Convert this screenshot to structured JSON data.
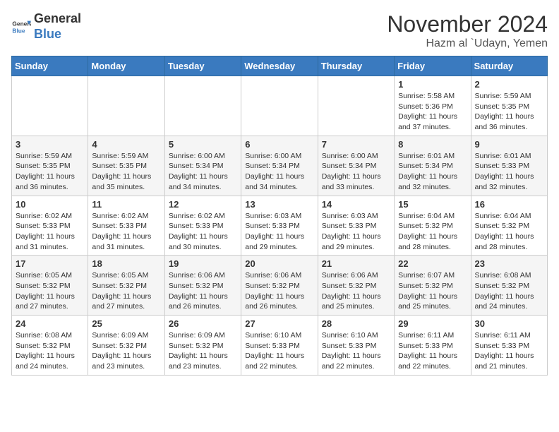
{
  "header": {
    "logo_general": "General",
    "logo_blue": "Blue",
    "month_year": "November 2024",
    "location": "Hazm al `Udayn, Yemen"
  },
  "weekdays": [
    "Sunday",
    "Monday",
    "Tuesday",
    "Wednesday",
    "Thursday",
    "Friday",
    "Saturday"
  ],
  "weeks": [
    [
      {
        "day": "",
        "info": ""
      },
      {
        "day": "",
        "info": ""
      },
      {
        "day": "",
        "info": ""
      },
      {
        "day": "",
        "info": ""
      },
      {
        "day": "",
        "info": ""
      },
      {
        "day": "1",
        "info": "Sunrise: 5:58 AM\nSunset: 5:36 PM\nDaylight: 11 hours and 37 minutes."
      },
      {
        "day": "2",
        "info": "Sunrise: 5:59 AM\nSunset: 5:35 PM\nDaylight: 11 hours and 36 minutes."
      }
    ],
    [
      {
        "day": "3",
        "info": "Sunrise: 5:59 AM\nSunset: 5:35 PM\nDaylight: 11 hours and 36 minutes."
      },
      {
        "day": "4",
        "info": "Sunrise: 5:59 AM\nSunset: 5:35 PM\nDaylight: 11 hours and 35 minutes."
      },
      {
        "day": "5",
        "info": "Sunrise: 6:00 AM\nSunset: 5:34 PM\nDaylight: 11 hours and 34 minutes."
      },
      {
        "day": "6",
        "info": "Sunrise: 6:00 AM\nSunset: 5:34 PM\nDaylight: 11 hours and 34 minutes."
      },
      {
        "day": "7",
        "info": "Sunrise: 6:00 AM\nSunset: 5:34 PM\nDaylight: 11 hours and 33 minutes."
      },
      {
        "day": "8",
        "info": "Sunrise: 6:01 AM\nSunset: 5:34 PM\nDaylight: 11 hours and 32 minutes."
      },
      {
        "day": "9",
        "info": "Sunrise: 6:01 AM\nSunset: 5:33 PM\nDaylight: 11 hours and 32 minutes."
      }
    ],
    [
      {
        "day": "10",
        "info": "Sunrise: 6:02 AM\nSunset: 5:33 PM\nDaylight: 11 hours and 31 minutes."
      },
      {
        "day": "11",
        "info": "Sunrise: 6:02 AM\nSunset: 5:33 PM\nDaylight: 11 hours and 31 minutes."
      },
      {
        "day": "12",
        "info": "Sunrise: 6:02 AM\nSunset: 5:33 PM\nDaylight: 11 hours and 30 minutes."
      },
      {
        "day": "13",
        "info": "Sunrise: 6:03 AM\nSunset: 5:33 PM\nDaylight: 11 hours and 29 minutes."
      },
      {
        "day": "14",
        "info": "Sunrise: 6:03 AM\nSunset: 5:33 PM\nDaylight: 11 hours and 29 minutes."
      },
      {
        "day": "15",
        "info": "Sunrise: 6:04 AM\nSunset: 5:32 PM\nDaylight: 11 hours and 28 minutes."
      },
      {
        "day": "16",
        "info": "Sunrise: 6:04 AM\nSunset: 5:32 PM\nDaylight: 11 hours and 28 minutes."
      }
    ],
    [
      {
        "day": "17",
        "info": "Sunrise: 6:05 AM\nSunset: 5:32 PM\nDaylight: 11 hours and 27 minutes."
      },
      {
        "day": "18",
        "info": "Sunrise: 6:05 AM\nSunset: 5:32 PM\nDaylight: 11 hours and 27 minutes."
      },
      {
        "day": "19",
        "info": "Sunrise: 6:06 AM\nSunset: 5:32 PM\nDaylight: 11 hours and 26 minutes."
      },
      {
        "day": "20",
        "info": "Sunrise: 6:06 AM\nSunset: 5:32 PM\nDaylight: 11 hours and 26 minutes."
      },
      {
        "day": "21",
        "info": "Sunrise: 6:06 AM\nSunset: 5:32 PM\nDaylight: 11 hours and 25 minutes."
      },
      {
        "day": "22",
        "info": "Sunrise: 6:07 AM\nSunset: 5:32 PM\nDaylight: 11 hours and 25 minutes."
      },
      {
        "day": "23",
        "info": "Sunrise: 6:08 AM\nSunset: 5:32 PM\nDaylight: 11 hours and 24 minutes."
      }
    ],
    [
      {
        "day": "24",
        "info": "Sunrise: 6:08 AM\nSunset: 5:32 PM\nDaylight: 11 hours and 24 minutes."
      },
      {
        "day": "25",
        "info": "Sunrise: 6:09 AM\nSunset: 5:32 PM\nDaylight: 11 hours and 23 minutes."
      },
      {
        "day": "26",
        "info": "Sunrise: 6:09 AM\nSunset: 5:32 PM\nDaylight: 11 hours and 23 minutes."
      },
      {
        "day": "27",
        "info": "Sunrise: 6:10 AM\nSunset: 5:33 PM\nDaylight: 11 hours and 22 minutes."
      },
      {
        "day": "28",
        "info": "Sunrise: 6:10 AM\nSunset: 5:33 PM\nDaylight: 11 hours and 22 minutes."
      },
      {
        "day": "29",
        "info": "Sunrise: 6:11 AM\nSunset: 5:33 PM\nDaylight: 11 hours and 22 minutes."
      },
      {
        "day": "30",
        "info": "Sunrise: 6:11 AM\nSunset: 5:33 PM\nDaylight: 11 hours and 21 minutes."
      }
    ]
  ]
}
